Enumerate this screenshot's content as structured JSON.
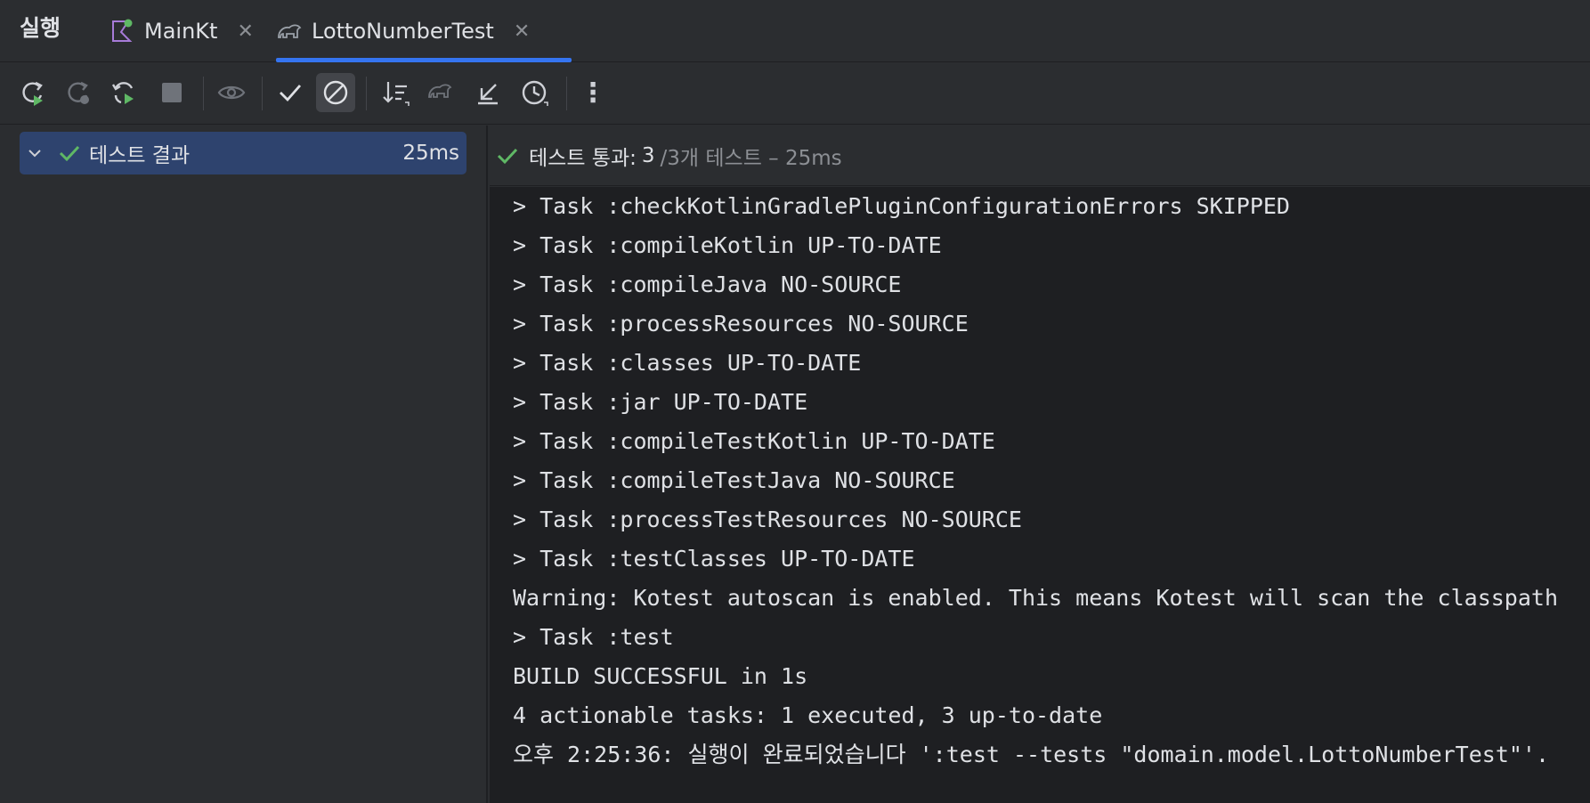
{
  "window": {
    "run_label": "실행",
    "tabs": [
      {
        "label": "MainKt",
        "icon": "kotlin-run-icon",
        "close": "✕"
      },
      {
        "label": "LottoNumberTest",
        "icon": "gradle-elephant-icon",
        "close": "✕"
      }
    ]
  },
  "toolbar": {
    "icons": [
      "rerun-icon",
      "rerun-failed-icon",
      "rerun-automatically-icon",
      "stop-icon",
      "show-ignored-icon",
      "show-passed-icon",
      "show-disabled-icon",
      "sort-icon",
      "import-tests-icon",
      "export-icon",
      "history-icon",
      "more-icon"
    ],
    "more_glyph": "⋮"
  },
  "tree": {
    "root_label": "테스트 결과",
    "root_duration": "25ms"
  },
  "status": {
    "passed_label": "테스트 통과:",
    "passed_count": "3",
    "rest": "/3개 테스트 – 25ms"
  },
  "console": {
    "lines": [
      "> Task :checkKotlinGradlePluginConfigurationErrors SKIPPED",
      "> Task :compileKotlin UP-TO-DATE",
      "> Task :compileJava NO-SOURCE",
      "> Task :processResources NO-SOURCE",
      "> Task :classes UP-TO-DATE",
      "> Task :jar UP-TO-DATE",
      "> Task :compileTestKotlin UP-TO-DATE",
      "> Task :compileTestJava NO-SOURCE",
      "> Task :processTestResources NO-SOURCE",
      "> Task :testClasses UP-TO-DATE",
      "Warning: Kotest autoscan is enabled. This means Kotest will scan the classpath",
      "> Task :test",
      "BUILD SUCCESSFUL in 1s",
      "4 actionable tasks: 1 executed, 3 up-to-date",
      "오후 2:25:36: 실행이 완료되었습니다 ':test --tests \"domain.model.LottoNumberTest\"'."
    ]
  },
  "colors": {
    "accent": "#3574f0",
    "success": "#5fb865",
    "selection": "#2e436e"
  }
}
